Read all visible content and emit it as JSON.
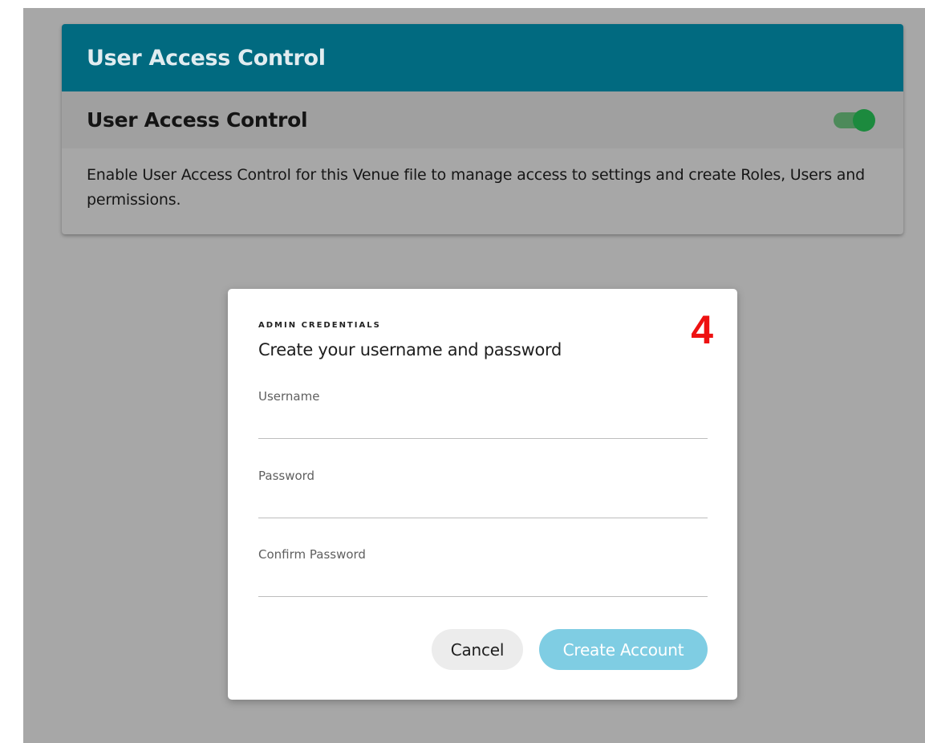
{
  "panel": {
    "header_title": "User Access Control",
    "setting": {
      "title": "User Access Control",
      "toggle_on": true,
      "description": "Enable User Access Control for this Venue file to manage access to settings and create Roles, Users and permissions."
    }
  },
  "dialog": {
    "eyebrow": "ADMIN CREDENTIALS",
    "title": "Create your username and password",
    "step_marker": "4",
    "fields": [
      {
        "label": "Username",
        "value": "",
        "placeholder": ""
      },
      {
        "label": "Password",
        "value": "",
        "placeholder": ""
      },
      {
        "label": "Confirm Password",
        "value": "",
        "placeholder": ""
      }
    ],
    "buttons": {
      "cancel_label": "Cancel",
      "create_label": "Create Account"
    }
  },
  "colors": {
    "header_bg": "#016a80",
    "toggle_on": "#1c8a3e",
    "primary_button": "#7fcde3",
    "step_marker": "#ee1111"
  },
  "icons": {
    "toggle": "toggle-switch-on"
  }
}
